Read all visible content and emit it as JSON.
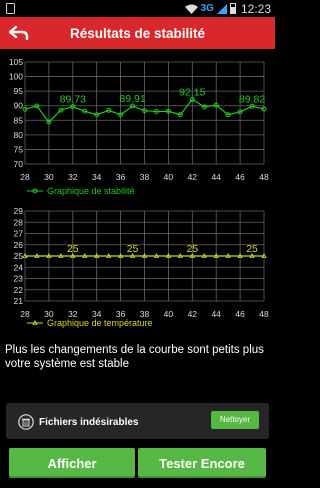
{
  "status_bar": {
    "network": "3G",
    "time": "12:23",
    "icons": [
      "notification-icon",
      "wifi-icon",
      "signal-icon",
      "battery-icon"
    ]
  },
  "header": {
    "title": "Résultats de stabilité",
    "back_icon": "back-arrow-icon",
    "color": "#d9282c"
  },
  "chart_data": [
    {
      "type": "line",
      "title": "",
      "legend": "Graphique de stabilité",
      "legend_position": "bottom-left",
      "color": "#22c81e",
      "grid": true,
      "y_ticks": [
        105,
        100,
        95,
        90,
        85,
        80,
        75,
        70
      ],
      "ylim": [
        70,
        105
      ],
      "x_ticks": [
        28,
        30,
        32,
        34,
        36,
        38,
        40,
        42,
        44,
        46,
        48
      ],
      "xlim": [
        28,
        48
      ],
      "x": [
        28,
        29,
        30,
        31,
        32,
        33,
        34,
        35,
        36,
        37,
        38,
        39,
        40,
        41,
        42,
        43,
        44,
        45,
        46,
        47,
        48
      ],
      "y": [
        88.8,
        89.9,
        84.4,
        88.5,
        89.7,
        88.1,
        86.9,
        88.4,
        86.9,
        89.9,
        88.3,
        88.0,
        88.1,
        86.9,
        92.2,
        89.6,
        90.2,
        86.9,
        87.9,
        89.8,
        88.9
      ],
      "annotations": [
        {
          "x": 32,
          "label": "89.73"
        },
        {
          "x": 37,
          "label": "89.91"
        },
        {
          "x": 42,
          "label": "92.15"
        },
        {
          "x": 47,
          "label": "89.82"
        }
      ]
    },
    {
      "type": "line",
      "title": "",
      "legend": "Graphique de température",
      "legend_position": "bottom-left",
      "color": "#d8d820",
      "grid": true,
      "y_ticks": [
        29,
        28,
        27,
        26,
        25,
        24,
        23,
        22,
        21
      ],
      "ylim": [
        21,
        29
      ],
      "x_ticks": [
        28,
        30,
        32,
        34,
        36,
        38,
        40,
        42,
        44,
        46,
        48
      ],
      "xlim": [
        28,
        48
      ],
      "x": [
        28,
        29,
        30,
        31,
        32,
        33,
        34,
        35,
        36,
        37,
        38,
        39,
        40,
        41,
        42,
        43,
        44,
        45,
        46,
        47,
        48
      ],
      "y": [
        25,
        25,
        25,
        25,
        25,
        25,
        25,
        25,
        25,
        25,
        25,
        25,
        25,
        25,
        25,
        25,
        25,
        25,
        25,
        25,
        25
      ],
      "annotations": [
        {
          "x": 32,
          "label": "25"
        },
        {
          "x": 37,
          "label": "25"
        },
        {
          "x": 42,
          "label": "25"
        },
        {
          "x": 47,
          "label": "25"
        }
      ]
    }
  ],
  "info": {
    "text": "Plus les changements de la courbe sont petits plus votre système est stable"
  },
  "junk": {
    "label": "Fichiers indésirables",
    "icon": "trash-icon",
    "button": "Nettoyer"
  },
  "buttons": {
    "show": "Afficher",
    "retest": "Tester Encore",
    "color": "#56b845"
  }
}
